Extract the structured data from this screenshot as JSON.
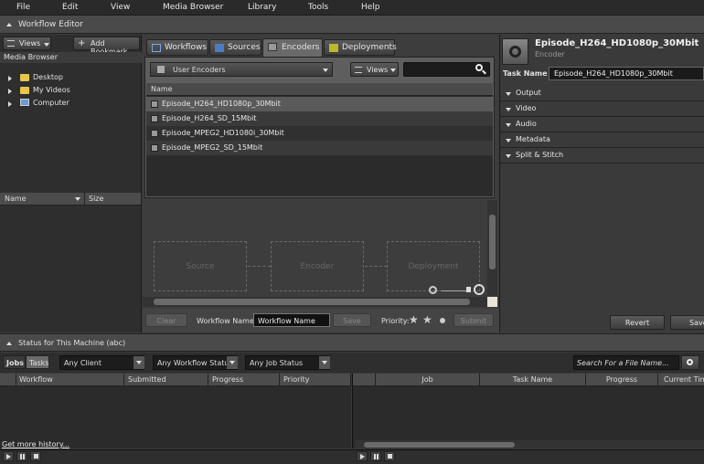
{
  "menu": [
    "File",
    "Edit",
    "View",
    "Media Browser",
    "Library",
    "Tools",
    "Help"
  ],
  "window_title": "Workflow Editor",
  "left": {
    "views_label": "Views",
    "add_bookmark_label": "Add Bookmark",
    "media_browser_label": "Media Browser",
    "tree": [
      "Desktop",
      "My Videos",
      "Computer"
    ],
    "col_name": "Name",
    "col_size": "Size"
  },
  "tabs": [
    "Workflows",
    "Sources",
    "Encoders",
    "Deployments"
  ],
  "encoders": {
    "dropdown_value": "User Encoders",
    "views_label": "Views",
    "col_name": "Name",
    "items": [
      "Episode_H264_HD1080p_30Mbit",
      "Episode_H264_SD_15Mbit",
      "Episode_MPEG2_HD1080i_30Mbit",
      "Episode_MPEG2_SD_15Mbit"
    ]
  },
  "canvas": {
    "boxes": [
      "Source",
      "Encoder",
      "Deployment"
    ]
  },
  "bottom_toolbar": {
    "clear_label": "Clear",
    "workflow_name_label": "Workflow Name:",
    "workflow_name_value": "Workflow Name",
    "save_label": "Save",
    "priority_label": "Priority:",
    "submit_label": "Submit"
  },
  "inspector": {
    "title": "Episode_H264_HD1080p_30Mbit",
    "subtitle": "Encoder",
    "task_name_label": "Task Name",
    "task_name_value": "Episode_H264_HD1080p_30Mbit",
    "sections": [
      "Output",
      "Video",
      "Audio",
      "Metadata",
      "Split & Stitch"
    ],
    "revert_label": "Revert",
    "save_label": "Save"
  },
  "status": {
    "title": "Status for This Machine (abc)",
    "jobs_tab": "Jobs",
    "tasks_tab": "Tasks",
    "filter_client": "Any Client",
    "filter_workflow": "Any Workflow Status",
    "filter_job": "Any Job Status",
    "search_placeholder": "Search For a File Name...",
    "left_cols": [
      "Workflow",
      "Submitted",
      "Progress",
      "Priority"
    ],
    "right_cols": [
      "Job",
      "Task Name",
      "Progress",
      "Current Time"
    ],
    "more_history": "Get more history..."
  },
  "colors": {
    "selected_row": "#5a5a5a",
    "active_tab": "#6a6a6a"
  }
}
